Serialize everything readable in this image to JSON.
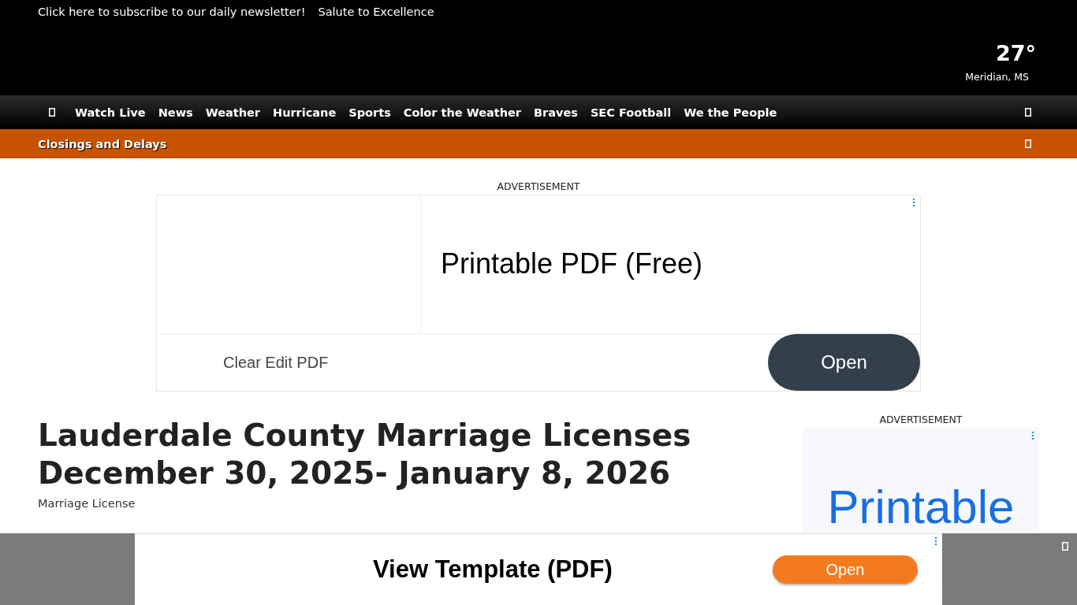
{
  "top_bar": {
    "links": [
      "Click here to subscribe to our daily newsletter!",
      "Salute to Excellence"
    ],
    "weather": {
      "temperature": "27°",
      "location": "Meridian, MS"
    }
  },
  "nav": {
    "items": [
      "Watch Live",
      "News",
      "Weather",
      "Hurricane",
      "Sports",
      "Color the Weather",
      "Braves",
      "SEC Football",
      "We the People"
    ]
  },
  "alert_bar": {
    "label": "Closings and Delays"
  },
  "top_ad": {
    "label": "ADVERTISEMENT",
    "headline": "Printable PDF (Free)",
    "subtext": "Clear Edit PDF",
    "button": "Open"
  },
  "article": {
    "title": "Lauderdale County Marriage Licenses December 30, 2025- January 8, 2026",
    "image_alt": "Marriage License"
  },
  "side_ad": {
    "label": "ADVERTISEMENT",
    "headline": "Printable"
  },
  "sticky_ad": {
    "headline": "View Template (PDF)",
    "button": "Open"
  }
}
